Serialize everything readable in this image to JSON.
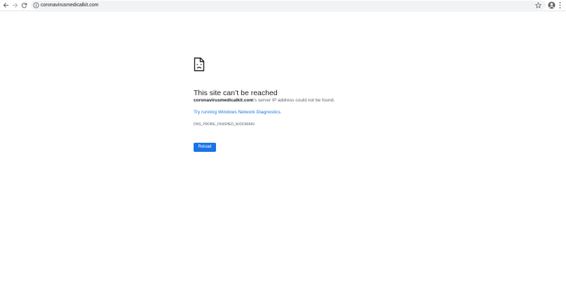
{
  "toolbar": {
    "back_icon": "back-arrow-icon",
    "forward_icon": "forward-arrow-icon",
    "reload_icon": "reload-icon",
    "omnibox": {
      "url": "coronavirusmedicalkit.com",
      "site_info_icon": "info-icon",
      "bookmark_icon": "star-icon"
    },
    "profile_icon": "avatar-icon",
    "menu_icon": "kebab-menu-icon"
  },
  "error_page": {
    "icon": "sad-document-icon",
    "heading": "This site can’t be reached",
    "host": "coronavirusmedicalkit.com",
    "message_suffix": "’s server IP address could not be found.",
    "diagnostics_link": "Try running Windows Network Diagnostics.",
    "error_code": "DNS_PROBE_FINISHED_NXDOMAIN",
    "reload_label": "Reload"
  },
  "colors": {
    "accent": "#1a73e8",
    "text_primary": "#202124",
    "text_secondary": "#5f6368",
    "omnibox_bg": "#f1f3f4"
  }
}
